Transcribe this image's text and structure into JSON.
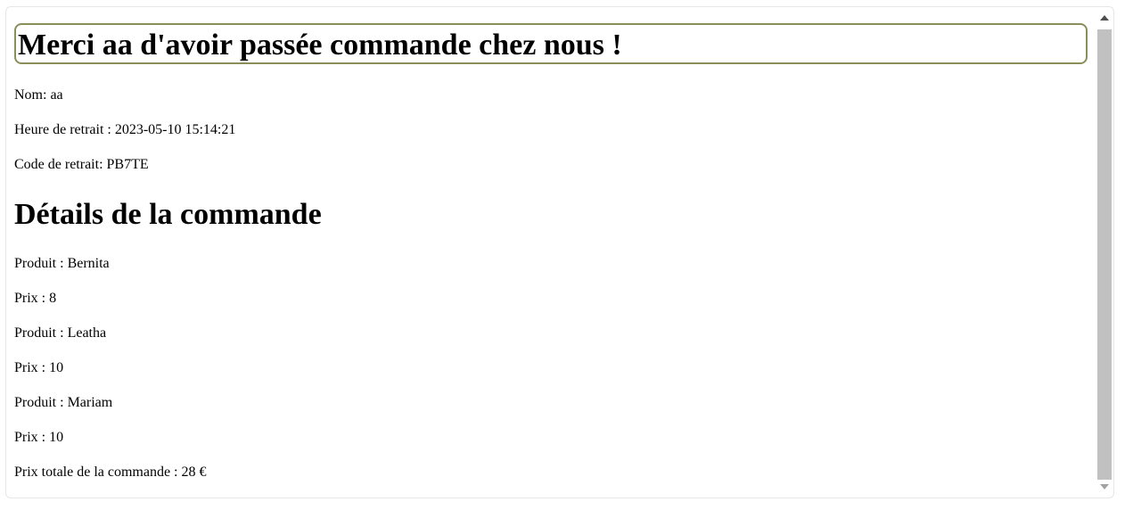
{
  "header": {
    "title": "Merci aa d'avoir passée commande chez nous !"
  },
  "order_info": {
    "name": "Nom: aa",
    "pickup_time": "Heure de retrait : 2023-05-10 15:14:21",
    "pickup_code": "Code de retrait: PB7TE"
  },
  "details": {
    "heading": "Détails de la commande",
    "items": [
      {
        "product": "Produit : Bernita",
        "price": "Prix : 8"
      },
      {
        "product": "Produit : Leatha",
        "price": "Prix : 10"
      },
      {
        "product": "Produit : Mariam",
        "price": "Prix : 10"
      }
    ],
    "total": "Prix totale de la commande : 28 €"
  },
  "icons": {
    "scroll_up": "triangle-up-icon",
    "scroll_down": "triangle-down-icon"
  },
  "colors": {
    "title_border": "#8a8f5a",
    "scroll_thumb": "#c1c1c1"
  }
}
